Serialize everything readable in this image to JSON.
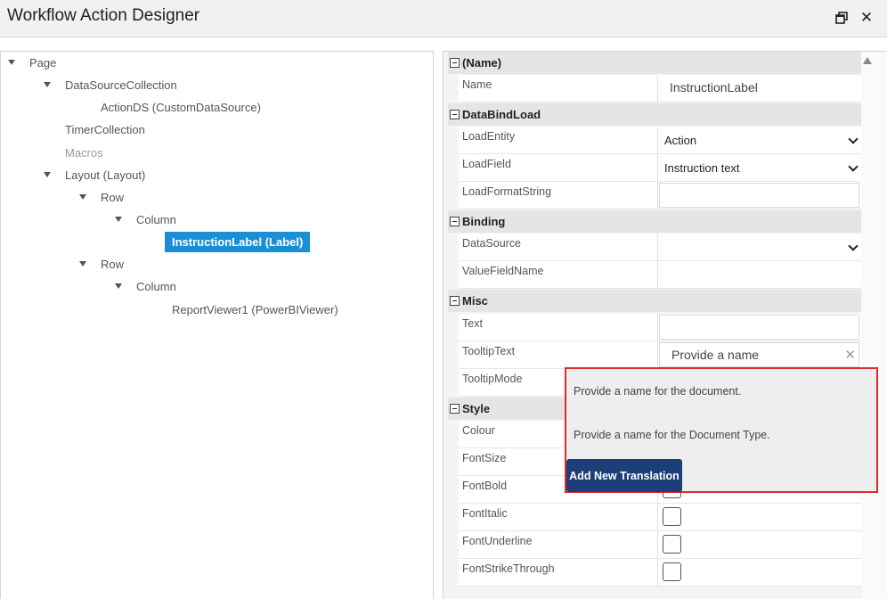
{
  "window": {
    "title": "Workflow Action Designer"
  },
  "tree": {
    "nodes": [
      {
        "label": "Page"
      },
      {
        "label": "DataSourceCollection"
      },
      {
        "label": "ActionDS (CustomDataSource)"
      },
      {
        "label": "TimerCollection"
      },
      {
        "label": "Macros"
      },
      {
        "label": "Layout (Layout)"
      },
      {
        "label": "Row"
      },
      {
        "label": "Column"
      },
      {
        "label": "InstructionLabel (Label)"
      },
      {
        "label": "Row"
      },
      {
        "label": "Column"
      },
      {
        "label": "ReportViewer1 (PowerBIViewer)"
      }
    ]
  },
  "properties": {
    "categories": {
      "name": "(Name)",
      "databindload": "DataBindLoad",
      "binding": "Binding",
      "misc": "Misc",
      "style": "Style"
    },
    "name": {
      "label": "Name",
      "value": "InstructionLabel"
    },
    "load_entity": {
      "label": "LoadEntity",
      "value": "Action"
    },
    "load_field": {
      "label": "LoadField",
      "value": "Instruction text"
    },
    "load_format_string": {
      "label": "LoadFormatString",
      "value": ""
    },
    "data_source": {
      "label": "DataSource",
      "value": ""
    },
    "value_field_name": {
      "label": "ValueFieldName",
      "value": ""
    },
    "text": {
      "label": "Text",
      "value": ""
    },
    "tooltip_text": {
      "label": "TooltipText",
      "value": "Provide a name"
    },
    "tooltip_mode": {
      "label": "TooltipMode"
    },
    "colour": {
      "label": "Colour"
    },
    "font_size": {
      "label": "FontSize"
    },
    "font_bold": {
      "label": "FontBold",
      "checked": false
    },
    "font_italic": {
      "label": "FontItalic",
      "checked": false
    },
    "font_underline": {
      "label": "FontUnderline",
      "checked": false
    },
    "font_strikethrough": {
      "label": "FontStrikeThrough",
      "checked": false
    }
  },
  "popup": {
    "suggestions": [
      "Provide a name for the document.",
      "Provide a name for the Document Type."
    ],
    "button_label": "Add New Translation"
  },
  "icons": {
    "restore": "restore-window-icon",
    "close": "close-icon",
    "clear": "clear-icon"
  },
  "colors": {
    "selection": "#1a8fd6",
    "button": "#1c3f7a",
    "highlight_border": "#dd2b2b"
  }
}
